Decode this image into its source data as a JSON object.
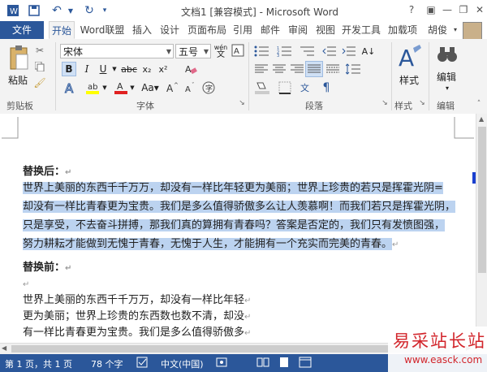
{
  "window": {
    "title": "文档1 [兼容模式] - Microsoft Word",
    "help": "?",
    "minimize": "—",
    "restore": "❐",
    "close": "✕"
  },
  "qat": {
    "save_icon": "floppy-icon",
    "undo": "↶",
    "redo": "↻"
  },
  "tabs": {
    "file": "文件",
    "home": "开始",
    "wordlm": "Word联盟",
    "insert": "插入",
    "design": "设计",
    "layout": "页面布局",
    "references": "引用",
    "mailings": "邮件",
    "review": "审阅",
    "view": "视图",
    "developer": "开发工具",
    "addins": "加载项",
    "user": "胡俊"
  },
  "ribbon": {
    "paste": "粘贴",
    "font_name": "宋体",
    "font_size": "五号",
    "wen": "wén",
    "groups": {
      "clipboard": "剪贴板",
      "font": "字体",
      "paragraph": "段落",
      "styles": "样式",
      "editing": "编辑"
    },
    "styles_btn": "样式",
    "editing_btn": "编辑"
  },
  "document": {
    "heading_after": "替换后：",
    "after_lines": [
      "世界上美丽的东西千千万万，却没有一样比年轻更为美丽；世界上珍贵的若只是挥霍光阴=",
      "却没有一样比青春更为宝贵。我们是多么值得骄傲多么让人羡慕啊！而我们若只是挥霍光阴，",
      "只是享受，不去奋斗拼搏，那我们真的算拥有青春吗？答案是否定的，我们只有发愤图强，",
      "努力耕耘才能做到无愧于青春，无愧于人生，才能拥有一个充实而完美的青春。"
    ],
    "heading_before": "替换前：",
    "before_lines": [
      "世界上美丽的东西千千万万，却没有一样比年轻",
      "更为美丽；世界上珍贵的东西数也数不清，却没",
      "有一样比青春更为宝贵。我们是多么值得骄傲多"
    ],
    "mark": "↵"
  },
  "status": {
    "page": "第 1 页，共 1 页",
    "words": "78 个字",
    "language": "中文(中国)"
  },
  "watermark": {
    "title": "易采站长站",
    "url": "www.easck.com"
  },
  "colors": {
    "accent": "#2b579a",
    "selection": "#bcd3f0",
    "watermark_red": "#d2252b"
  }
}
